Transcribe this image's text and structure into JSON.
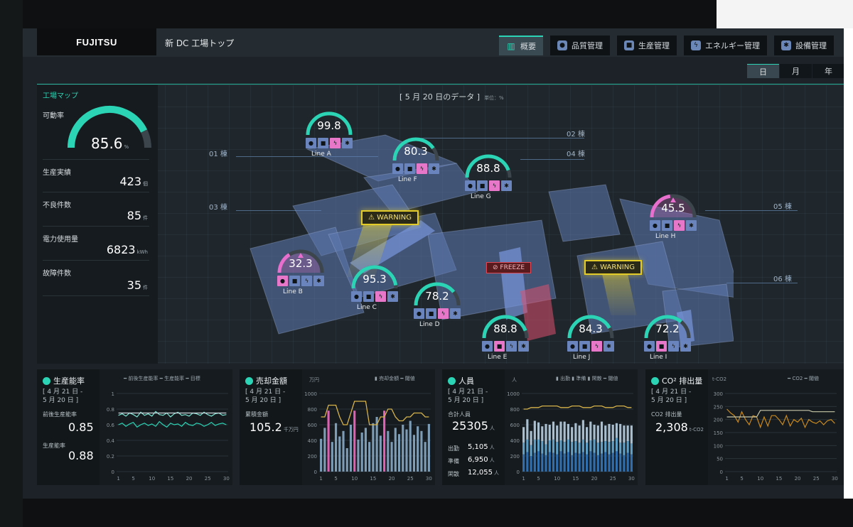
{
  "header": {
    "logo": "FUJITSU",
    "title": "新 DC 工場トップ",
    "tabs": [
      {
        "label": "概要",
        "icon": "bar-chart-icon",
        "active": true
      },
      {
        "label": "品質管理",
        "icon": "person-icon",
        "active": false
      },
      {
        "label": "生産管理",
        "icon": "box-icon",
        "active": false
      },
      {
        "label": "エネルギー管理",
        "icon": "lightning-icon",
        "active": false
      },
      {
        "label": "設備管理",
        "icon": "gear-icon",
        "active": false
      }
    ],
    "periods": [
      {
        "label": "日",
        "active": true
      },
      {
        "label": "月",
        "active": false
      },
      {
        "label": "年",
        "active": false
      }
    ]
  },
  "kpi": {
    "title": "工場マップ",
    "operating_rate_label": "可動率",
    "operating_rate_value": "85.6",
    "operating_rate_unit": "%",
    "operating_rate_fraction": 0.856,
    "items": [
      {
        "label": "生産実績",
        "value": "423",
        "unit": "個"
      },
      {
        "label": "不良件数",
        "value": "85",
        "unit": "件"
      },
      {
        "label": "電力使用量",
        "value": "6823",
        "unit": "kWh"
      },
      {
        "label": "故障件数",
        "value": "35",
        "unit": "件"
      }
    ]
  },
  "map": {
    "date_title": "[ 5 月 20 日のデータ ]",
    "unit_note": "単位：%",
    "buildings": [
      "01 棟",
      "02 棟",
      "03 棟",
      "04 棟",
      "05 棟",
      "06 棟"
    ],
    "warning_label": "WARNING",
    "freeze_label": "FREEZE",
    "lines": [
      {
        "name": "Line A",
        "value": "99.8",
        "fraction": 0.998,
        "alert": false,
        "pink_icon": 2
      },
      {
        "name": "Line F",
        "value": "80.3",
        "fraction": 0.803,
        "alert": false,
        "pink_icon": 2
      },
      {
        "name": "Line G",
        "value": "88.8",
        "fraction": 0.888,
        "alert": false,
        "pink_icon": 2
      },
      {
        "name": "Line H",
        "value": "45.5",
        "fraction": 0.455,
        "alert": true,
        "pink_icon": 2
      },
      {
        "name": "Line B",
        "value": "32.3",
        "fraction": 0.323,
        "alert": true,
        "pink_icon": 0
      },
      {
        "name": "Line C",
        "value": "95.3",
        "fraction": 0.953,
        "alert": false,
        "pink_icon": 2
      },
      {
        "name": "Line D",
        "value": "78.2",
        "fraction": 0.782,
        "alert": false,
        "pink_icon": 2
      },
      {
        "name": "Line E",
        "value": "88.8",
        "fraction": 0.888,
        "alert": false,
        "pink_icon": 1
      },
      {
        "name": "Line J",
        "value": "84.3",
        "fraction": 0.843,
        "alert": false,
        "pink_icon": 2
      },
      {
        "name": "Line I",
        "value": "72.2",
        "fraction": 0.722,
        "alert": false,
        "pink_icon": 1
      }
    ]
  },
  "cards": {
    "productivity": {
      "title": "生産能率",
      "date": "[ 4 月 21 日 -\n5 月 20 日 ]",
      "label1": "前後生産能率",
      "value1": "0.85",
      "label2": "生産能率",
      "value2": "0.88",
      "legend": "━ 前後生産能率 ━ 生産能率 ━ 目標"
    },
    "sales": {
      "title": "売却金額",
      "date": "[ 4 月 21 日 -\n5 月 20 日 ]",
      "label1": "累積金額",
      "value1": "105.2",
      "unit1": "千万円",
      "unit_axis": "万円",
      "legend": "▮ 売却金額 ━ 閾値"
    },
    "staff": {
      "title": "人員",
      "date": "[ 4 月 21 日 -\n5 月 20 日 ]",
      "label_total": "合計人員",
      "value_total": "25305",
      "unit_total": "人",
      "rows": [
        {
          "label": "出勤",
          "value": "5,105",
          "unit": "人"
        },
        {
          "label": "準備",
          "value": "6,950",
          "unit": "人"
        },
        {
          "label": "閑散",
          "value": "12,055",
          "unit": "人"
        }
      ],
      "unit_axis": "人",
      "legend": "▮ 出勤 ▮ 準備 ▮ 閑散 ━ 閾値"
    },
    "co2": {
      "title": "CO² 排出量",
      "date": "[ 4 月 21 日 -\n5 月 20 日 ]",
      "label1": "CO2 排出量",
      "value1": "2,308",
      "unit1": "t-CO2",
      "unit_axis": "t-CO2",
      "legend": "━ CO2 ━ 閾値"
    }
  },
  "chart_data": [
    {
      "type": "line",
      "title": "生産能率",
      "x": [
        1,
        2,
        3,
        4,
        5,
        6,
        7,
        8,
        9,
        10,
        11,
        12,
        13,
        14,
        15,
        16,
        17,
        18,
        19,
        20,
        21,
        22,
        23,
        24,
        25,
        26,
        27,
        28,
        29,
        30
      ],
      "ylim": [
        0,
        1
      ],
      "yticks": [
        0,
        0.2,
        0.4,
        0.6,
        0.8,
        1
      ],
      "xticks": [
        1,
        5,
        10,
        15,
        20,
        25,
        30
      ],
      "series": [
        {
          "name": "前後生産能率",
          "color": "#7ee7d4",
          "values": [
            0.72,
            0.74,
            0.71,
            0.75,
            0.73,
            0.7,
            0.76,
            0.72,
            0.74,
            0.71,
            0.77,
            0.73,
            0.72,
            0.75,
            0.7,
            0.74,
            0.76,
            0.72,
            0.73,
            0.71,
            0.75,
            0.74,
            0.72,
            0.76,
            0.73,
            0.71,
            0.74,
            0.75,
            0.72,
            0.73
          ]
        },
        {
          "name": "生産能率",
          "color": "#2bd4b4",
          "values": [
            0.6,
            0.62,
            0.58,
            0.61,
            0.63,
            0.57,
            0.6,
            0.62,
            0.59,
            0.61,
            0.58,
            0.64,
            0.6,
            0.57,
            0.62,
            0.6,
            0.61,
            0.58,
            0.63,
            0.6,
            0.59,
            0.62,
            0.61,
            0.58,
            0.6,
            0.63,
            0.59,
            0.61,
            0.62,
            0.6
          ]
        },
        {
          "name": "目標",
          "color": "#c8d2d8",
          "values": [
            0.75,
            0.75,
            0.75,
            0.75,
            0.75,
            0.75,
            0.75,
            0.75,
            0.75,
            0.75,
            0.75,
            0.75,
            0.75,
            0.75,
            0.75,
            0.75,
            0.75,
            0.75,
            0.75,
            0.75,
            0.75,
            0.75,
            0.75,
            0.75,
            0.75,
            0.75,
            0.75,
            0.75,
            0.75,
            0.75
          ]
        }
      ]
    },
    {
      "type": "bar",
      "title": "売却金額",
      "x": [
        1,
        2,
        3,
        4,
        5,
        6,
        7,
        8,
        9,
        10,
        11,
        12,
        13,
        14,
        15,
        16,
        17,
        18,
        19,
        20,
        21,
        22,
        23,
        24,
        25,
        26,
        27,
        28,
        29,
        30
      ],
      "ylim": [
        0,
        1000
      ],
      "yticks": [
        0,
        200,
        400,
        600,
        800,
        1000
      ],
      "xticks": [
        1,
        5,
        10,
        15,
        20,
        25,
        30
      ],
      "highlight_x": [
        3,
        10,
        18
      ],
      "series": [
        {
          "name": "売却金額",
          "color": "#7d9cb6",
          "values": [
            420,
            560,
            780,
            380,
            620,
            450,
            520,
            300,
            600,
            780,
            410,
            500,
            560,
            380,
            620,
            700,
            460,
            780,
            520,
            380,
            560,
            480,
            600,
            540,
            650,
            470,
            580,
            520,
            380,
            610
          ]
        },
        {
          "name": "閾値",
          "color": "#d6b24a",
          "values": [
            700,
            700,
            850,
            850,
            850,
            700,
            600,
            600,
            750,
            900,
            900,
            900,
            900,
            600,
            600,
            600,
            700,
            700,
            800,
            800,
            700,
            650,
            650,
            700,
            700,
            750,
            750,
            750,
            700,
            700
          ]
        }
      ]
    },
    {
      "type": "bar",
      "title": "人員",
      "x": [
        1,
        2,
        3,
        4,
        5,
        6,
        7,
        8,
        9,
        10,
        11,
        12,
        13,
        14,
        15,
        16,
        17,
        18,
        19,
        20,
        21,
        22,
        23,
        24,
        25,
        26,
        27,
        28,
        29,
        30
      ],
      "ylim": [
        0,
        1000
      ],
      "yticks": [
        0,
        200,
        400,
        600,
        800,
        1000
      ],
      "xticks": [
        1,
        5,
        10,
        15,
        20,
        25,
        30
      ],
      "series": [
        {
          "name": "出勤",
          "color": "#2f6fb0",
          "values": [
            220,
            250,
            200,
            240,
            260,
            230,
            210,
            250,
            240,
            220,
            260,
            230,
            250,
            210,
            240,
            230,
            250,
            220,
            260,
            240,
            210,
            230,
            250,
            220,
            240,
            260,
            230,
            210,
            240,
            220
          ]
        },
        {
          "name": "準備",
          "color": "#5fa0c8",
          "values": [
            150,
            160,
            140,
            170,
            150,
            160,
            140,
            150,
            170,
            160,
            140,
            150,
            160,
            170,
            150,
            140,
            160,
            150,
            140,
            170,
            160,
            150,
            140,
            160,
            150,
            170,
            140,
            160,
            150,
            140
          ]
        },
        {
          "name": "閑散",
          "color": "#a9bfcf",
          "values": [
            200,
            260,
            180,
            240,
            220,
            190,
            260,
            200,
            230,
            210,
            240,
            260,
            200,
            190,
            230,
            220,
            250,
            200,
            240,
            190,
            220,
            260,
            200,
            230,
            210,
            190,
            240,
            220,
            200,
            230
          ]
        },
        {
          "name": "閾値",
          "color": "#d6b24a",
          "values": [
            800,
            800,
            820,
            820,
            820,
            840,
            840,
            840,
            840,
            840,
            820,
            820,
            820,
            840,
            840,
            840,
            820,
            820,
            820,
            840,
            840,
            840,
            820,
            820,
            820,
            840,
            840,
            840,
            820,
            820
          ]
        }
      ]
    },
    {
      "type": "line",
      "title": "CO² 排出量",
      "x": [
        1,
        2,
        3,
        4,
        5,
        6,
        7,
        8,
        9,
        10,
        11,
        12,
        13,
        14,
        15,
        16,
        17,
        18,
        19,
        20,
        21,
        22,
        23,
        24,
        25,
        26,
        27,
        28,
        29,
        30
      ],
      "ylim": [
        0,
        300
      ],
      "yticks": [
        0,
        50,
        100,
        150,
        200,
        250,
        300
      ],
      "xticks": [
        1,
        5,
        10,
        15,
        20,
        25,
        30
      ],
      "series": [
        {
          "name": "CO2",
          "color": "#c8891c",
          "values": [
            240,
            225,
            215,
            190,
            230,
            200,
            180,
            215,
            210,
            170,
            210,
            175,
            215,
            215,
            200,
            180,
            215,
            175,
            200,
            190,
            205,
            170,
            200,
            190,
            185,
            195,
            180,
            195,
            200,
            185
          ]
        },
        {
          "name": "閾値",
          "color": "#c8c8a8",
          "values": [
            210,
            210,
            210,
            210,
            210,
            210,
            210,
            210,
            210,
            235,
            235,
            235,
            235,
            235,
            235,
            235,
            235,
            235,
            235,
            235,
            235,
            235,
            235,
            230,
            230,
            230,
            230,
            230,
            230,
            230
          ]
        }
      ]
    }
  ]
}
